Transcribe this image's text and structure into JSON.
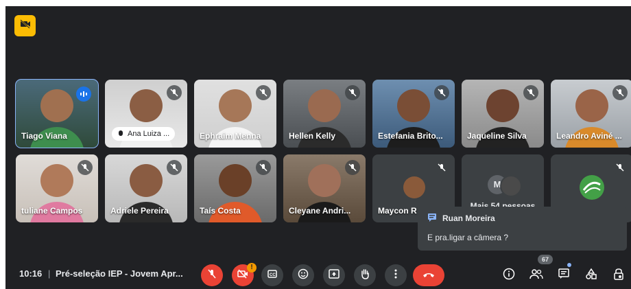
{
  "tiles": [
    {
      "name": "Tiago Viana"
    },
    {
      "name": "Ana Luiza ..."
    },
    {
      "name": "Ephraim Menna"
    },
    {
      "name": "Hellen Kelly"
    },
    {
      "name": "Estefania Brito..."
    },
    {
      "name": "Jaqueline Silva"
    },
    {
      "name": "Leandro Aviné ..."
    },
    {
      "name": "tuliane Campos"
    },
    {
      "name": "Adriele Pereira"
    },
    {
      "name": "Taís Costa"
    },
    {
      "name": "Cleyane Andri..."
    },
    {
      "name": "Maycon R"
    }
  ],
  "more_tile": {
    "label": "Mais 54 pessoas",
    "avatar_letter": "M"
  },
  "chat_notification": {
    "sender": "Ruan Moreira",
    "message": "E pra.ligar a câmera ?"
  },
  "bottom_bar": {
    "time": "10:16",
    "separator": "|",
    "meeting_title": "Pré-seleção IEP - Jovem Apr...",
    "participant_count": "67",
    "camera_alert": "!"
  },
  "colors": {
    "background": "#202124",
    "tile": "#3c4043",
    "accent_blue": "#1a73e8",
    "danger_red": "#ea4335",
    "badge_yellow": "#fbbc04"
  }
}
